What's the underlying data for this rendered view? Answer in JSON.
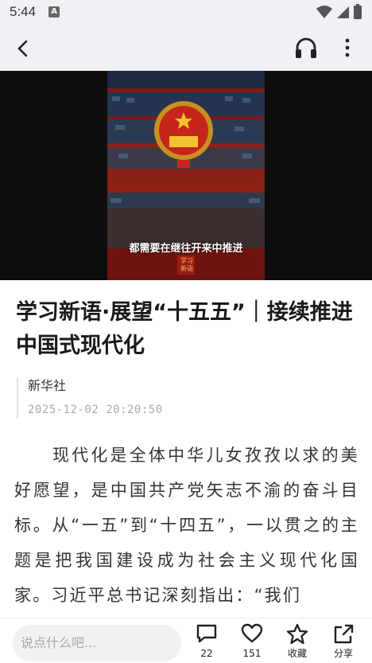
{
  "status_bar": {
    "time": "5:44",
    "notification_icon": "A"
  },
  "app_bar": {
    "back_icon": "chevron-left-icon",
    "listen_icon": "headphones-icon",
    "more_icon": "more-vertical-icon"
  },
  "video": {
    "caption": "都需要在继往开来中推进",
    "watermark": "学习新语"
  },
  "article": {
    "title": "学习新语·展望“十五五”｜接续推进中国式现代化",
    "source": "新华社",
    "datetime": "2025-12-02 20:20:50",
    "body": "现代化是全体中华儿女孜孜以求的美好愿望，是中国共产党矢志不渝的奋斗目标。从“一五”到“十四五”，一以贯之的主题是把我国建设成为社会主义现代化国家。习近平总书记深刻指出：“我们"
  },
  "bottom_bar": {
    "comment_placeholder": "说点什么吧...",
    "comments_count": "22",
    "likes_count": "151",
    "favorite_label": "收藏",
    "share_label": "分享"
  },
  "colors": {
    "background": "#ffffff",
    "bar_background": "#f1f1f5",
    "text": "#222222",
    "video_bg": "#0d0d0d"
  }
}
